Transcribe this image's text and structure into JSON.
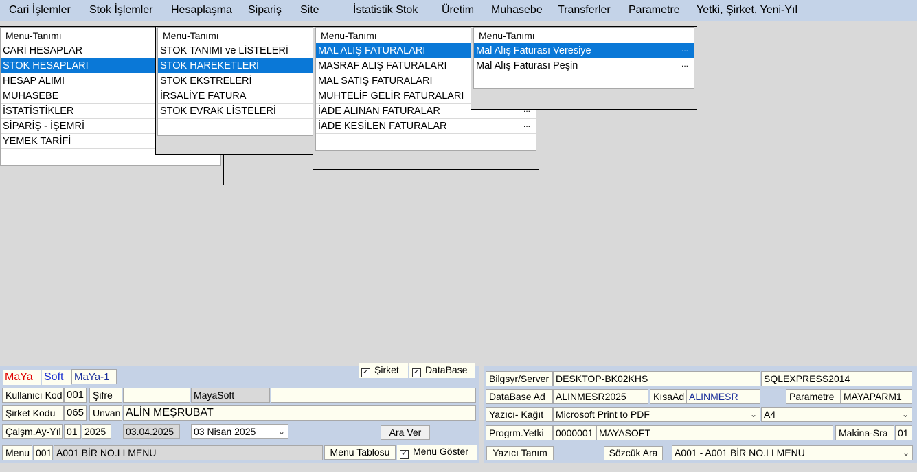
{
  "menubar": {
    "items": [
      "Cari İşlemler",
      "Stok İşlemler",
      "Hesaplaşma",
      "Sipariş",
      "Site",
      "İstatistik Stok",
      "Üretim",
      "Muhasebe",
      "Transferler",
      "Parametre",
      "Yetki, Şirket, Yeni-Yıl"
    ]
  },
  "menus": [
    {
      "header": "Menu-Tanımı",
      "rows": [
        "CARİ HESAPLAR",
        "STOK HESAPLARI",
        "HESAP ALIMI",
        "MUHASEBE",
        "İSTATİSTİKLER",
        "SİPARİŞ - İŞEMRİ",
        "YEMEK TARİFİ"
      ],
      "selected": 1
    },
    {
      "header": "Menu-Tanımı",
      "rows": [
        "STOK TANIMI ve LİSTELERİ",
        "STOK HAREKETLERİ",
        "STOK EKSTRELERİ",
        "İRSALİYE FATURA",
        "STOK EVRAK LİSTELERİ"
      ],
      "selected": 1
    },
    {
      "header": "Menu-Tanımı",
      "rows": [
        "MAL ALIŞ FATURALARI",
        "MASRAF ALIŞ FATURALARI",
        "MAL SATIŞ FATURALARI",
        "MUHTELİF GELİR FATURALARI",
        "İADE ALINAN FATURALAR",
        "İADE KESİLEN FATURALAR"
      ],
      "selected": 0
    },
    {
      "header": "Menu-Tanımı",
      "rows": [
        "Mal Alış Faturası Veresiye",
        "Mal Alış Faturası Peşin"
      ],
      "selected": 0
    }
  ],
  "dots": "...",
  "left": {
    "brand_maya": "MaYa",
    "brand_soft": "Soft",
    "brand_ver": "MaYa-1",
    "chk_sirket": "Şirket",
    "chk_database": "DataBase",
    "kullanici_label": "Kullanıcı Kod",
    "kullanici_value": "001",
    "sifre_label": "Şifre",
    "sifre_value": "",
    "user_name": "MayaSoft",
    "user_extra": "",
    "sirket_label": "Şirket Kodu",
    "sirket_value": "065",
    "unvan_label": "Unvan",
    "unvan_value": "ALİN MEŞRUBAT",
    "calisma_label": "Çalşm.Ay-Yıl",
    "ay_value": "01",
    "yil_value": "2025",
    "date_value": "03.04.2025",
    "date_combo": "03    Nisan    2025",
    "ara_ver": "Ara Ver",
    "menu_label": "Menu",
    "menu_code": "001",
    "menu_name": "A001  BİR NO.LI MENU",
    "menu_tablosu": "Menu Tablosu",
    "menu_goster": "Menu Göster"
  },
  "right": {
    "server_label": "Bilgsyr/Server",
    "server_value": "DESKTOP-BK02KHS",
    "instance_value": "SQLEXPRESS2014",
    "db_label": "DataBase Ad",
    "db_value": "ALINMESR2025",
    "kisa_label": "KısaAd",
    "kisa_value": "ALINMESR",
    "param_label": "Parametre",
    "param_value": "MAYAPARM1",
    "printer_label": "Yazıcı- Kağıt",
    "printer_value": "Microsoft Print to PDF",
    "paper_value": "A4",
    "yetki_label": "Progrm.Yetki",
    "yetki_code": "0000001",
    "yetki_name": "MAYASOFT",
    "makina_label": "Makina-Sra",
    "makina_value": "01",
    "yazici_tanim": "Yazıcı Tanım",
    "sozcuk_ara": "Sözcük Ara",
    "menu_combo": "A001 - A001  BİR NO.LI MENU"
  },
  "colors": {
    "selection": "#0a78d7",
    "brand_red": "#e00000",
    "brand_blue": "#1a2fd0"
  }
}
